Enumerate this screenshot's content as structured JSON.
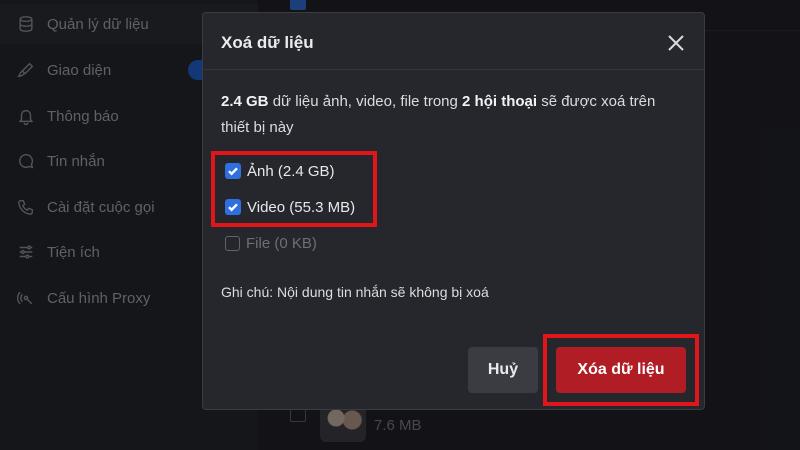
{
  "sidebar": {
    "items": [
      {
        "label": "Quản lý dữ liệu",
        "icon": "database-icon"
      },
      {
        "label": "Giao diện",
        "icon": "brush-icon"
      },
      {
        "label": "Thông báo",
        "icon": "bell-icon"
      },
      {
        "label": "Tin nhắn",
        "icon": "chat-icon"
      },
      {
        "label": "Cài đặt cuộc gọi",
        "icon": "phone-icon"
      },
      {
        "label": "Tiện ích",
        "icon": "sliders-icon"
      },
      {
        "label": "Cấu hình Proxy",
        "icon": "proxy-icon"
      }
    ]
  },
  "background": {
    "file_size": "7.6 MB"
  },
  "dialog": {
    "title": "Xoá dữ liệu",
    "desc_size": "2.4 GB",
    "desc_mid": " dữ liệu ảnh, video, file trong ",
    "desc_convs": "2 hội thoại",
    "desc_end": " sẽ được xoá trên thiết bị này",
    "options": [
      {
        "label": "Ảnh (2.4 GB)",
        "checked": true
      },
      {
        "label": "Video (55.3 MB)",
        "checked": true
      },
      {
        "label": "File (0 KB)",
        "checked": false
      }
    ],
    "note": "Ghi chú: Nội dung tin nhắn sẽ không bị xoá",
    "cancel_label": "Huỷ",
    "confirm_label": "Xóa dữ liệu"
  },
  "colors": {
    "accent": "#2f6fe0",
    "danger": "#b01d24",
    "highlight": "#e0161b"
  }
}
